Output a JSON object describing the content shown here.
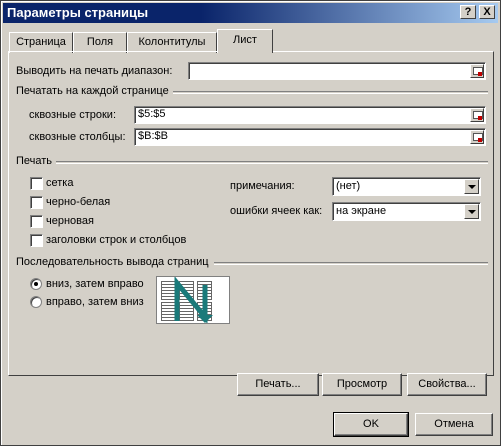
{
  "window": {
    "title": "Параметры страницы",
    "help_btn": "?",
    "close_btn": "X"
  },
  "tabs": [
    "Страница",
    "Поля",
    "Колонтитулы",
    "Лист"
  ],
  "active_tab": "Лист",
  "print_area": {
    "label": "Выводить на печать диапазон:",
    "value": ""
  },
  "print_titles": {
    "group": "Печатать на каждой странице",
    "rows_label": "сквозные строки:",
    "rows_value": "$5:$5",
    "cols_label": "сквозные столбцы:",
    "cols_value": "$B:$B"
  },
  "print": {
    "group": "Печать",
    "checks": [
      {
        "label": "сетка",
        "checked": false
      },
      {
        "label": "черно-белая",
        "checked": false
      },
      {
        "label": "черновая",
        "checked": false
      },
      {
        "label": "заголовки строк и столбцов",
        "checked": false
      }
    ],
    "comments_label": "примечания:",
    "comments_value": "(нет)",
    "errors_label": "ошибки ячеек как:",
    "errors_value": "на экране"
  },
  "page_order": {
    "group": "Последовательность вывода страниц",
    "options": [
      {
        "label": "вниз, затем вправо",
        "selected": true
      },
      {
        "label": "вправо, затем вниз",
        "selected": false
      }
    ]
  },
  "buttons": {
    "print": "Печать...",
    "preview": "Просмотр",
    "options": "Свойства...",
    "ok": "OK",
    "cancel": "Отмена"
  },
  "colors": {
    "title_bg": "#0a246a",
    "face": "#d4d0c8",
    "arrow": "#1a7a7a"
  }
}
